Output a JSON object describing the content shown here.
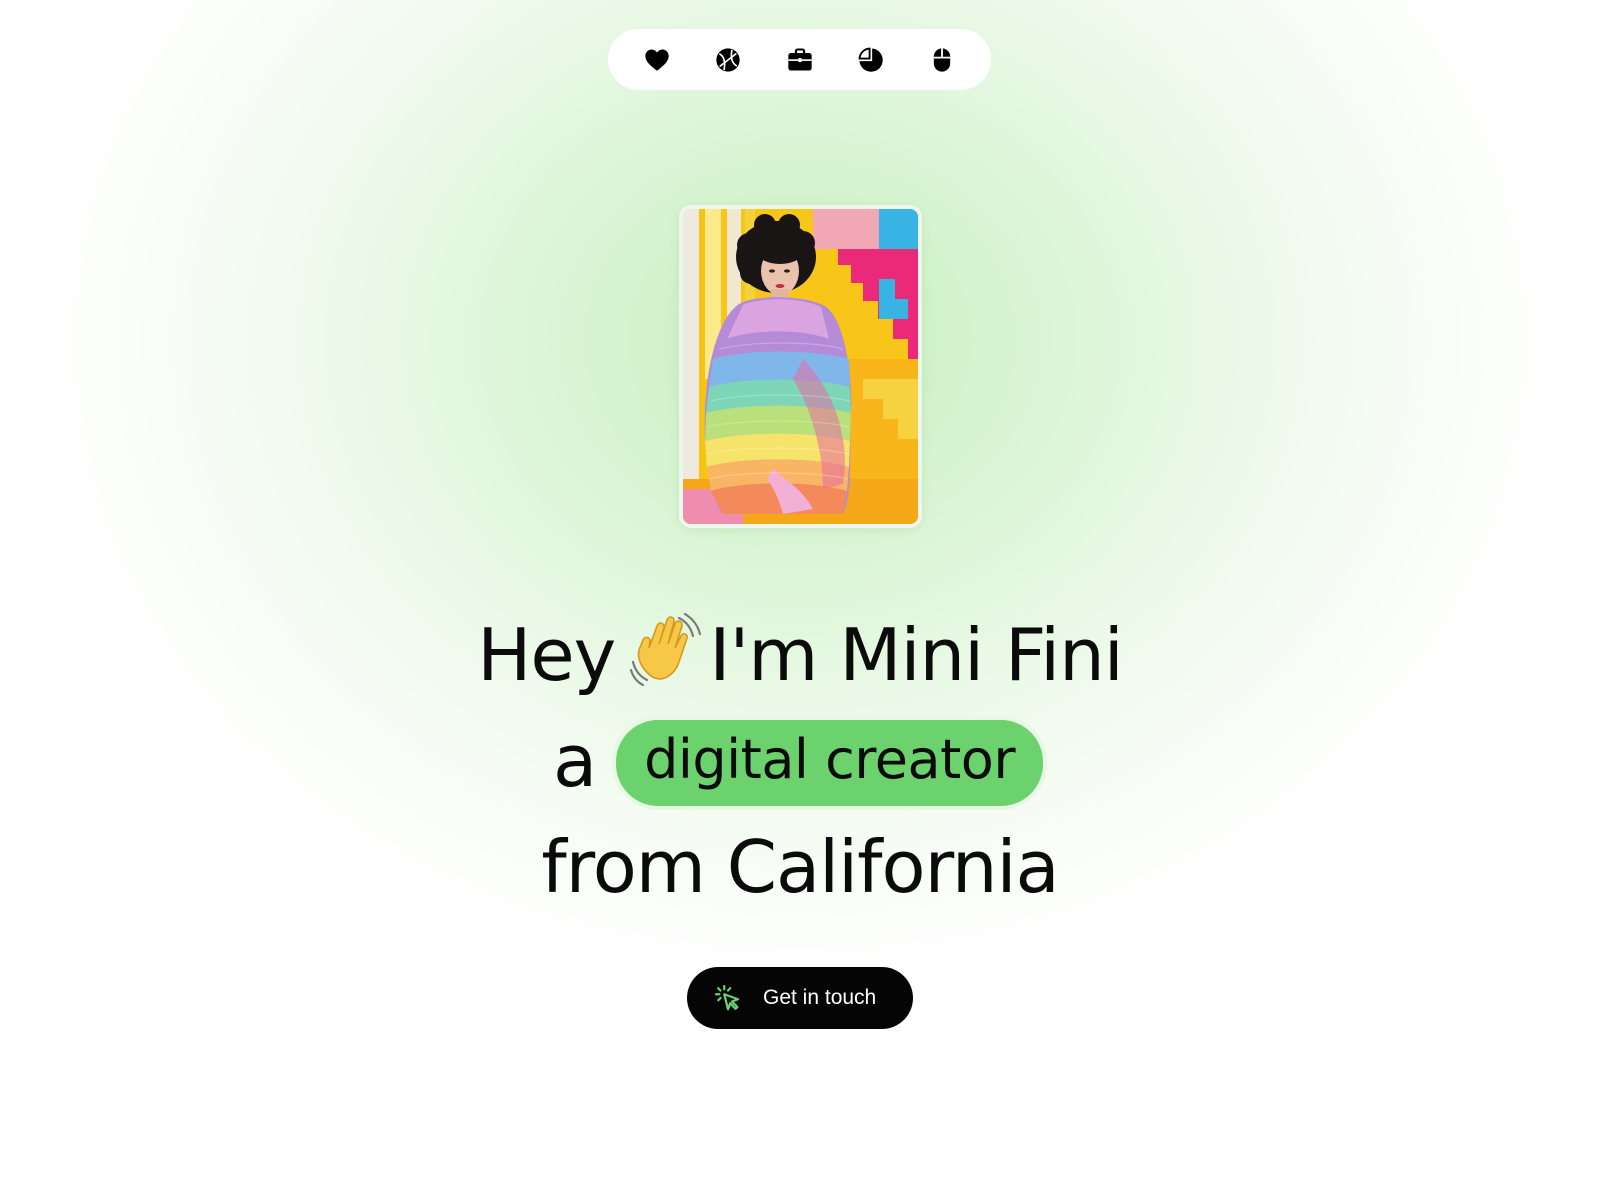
{
  "nav": {
    "icons": [
      "heart-icon",
      "basketball-icon",
      "briefcase-icon",
      "pie-chart-icon",
      "mouse-icon"
    ]
  },
  "hero": {
    "line1_before": "Hey",
    "wave_emoji": "wave-emoji",
    "line1_after": "I'm Mini Fini",
    "line2_prefix": "a",
    "highlight": "digital creator",
    "line3": "from California"
  },
  "cta": {
    "label": "Get in touch",
    "icon": "cursor-click-icon"
  },
  "colors": {
    "accent": "#6bd26d",
    "button_bg": "#050505",
    "text": "#0b0b0b",
    "background_glow": "#c7efc2"
  }
}
